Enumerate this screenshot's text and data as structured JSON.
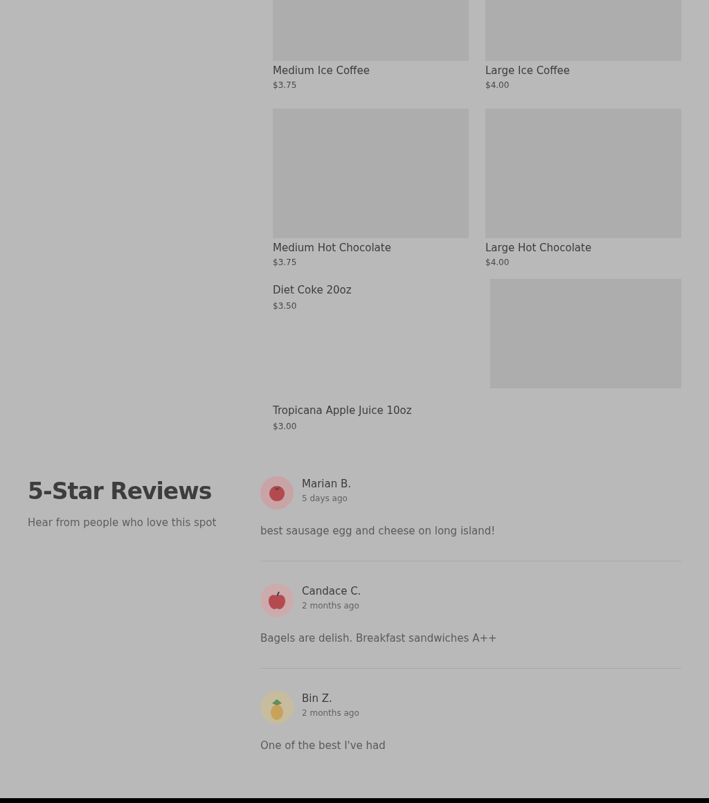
{
  "menu_items": [
    {
      "kind": "tile",
      "name": "Medium Ice Coffee",
      "price": "$3.75"
    },
    {
      "kind": "tile",
      "name": "Large Ice Coffee",
      "price": "$4.00"
    },
    {
      "kind": "tile",
      "name": "Medium Hot Chocolate",
      "price": "$3.75"
    },
    {
      "kind": "tile",
      "name": "Large Hot Chocolate",
      "price": "$4.00"
    },
    {
      "kind": "row",
      "name": "Diet Coke 20oz",
      "price": "$3.50"
    },
    {
      "kind": "text",
      "name": "Tropicana Apple Juice 10oz",
      "price": "$3.00"
    }
  ],
  "reviews_section": {
    "title": "5-Star Reviews",
    "subtitle": "Hear from people who love this spot"
  },
  "reviews": [
    {
      "name": "Marian B.",
      "time": "5 days ago",
      "kind": "tomato",
      "text": "best sausage egg and cheese on long island!"
    },
    {
      "name": "Candace C.",
      "time": "2 months ago",
      "kind": "apple",
      "text": "Bagels are delish. Breakfast sandwiches A++"
    },
    {
      "name": "Bin Z.",
      "time": "2 months ago",
      "kind": "pineapple",
      "text": "One of the best I've had"
    }
  ]
}
